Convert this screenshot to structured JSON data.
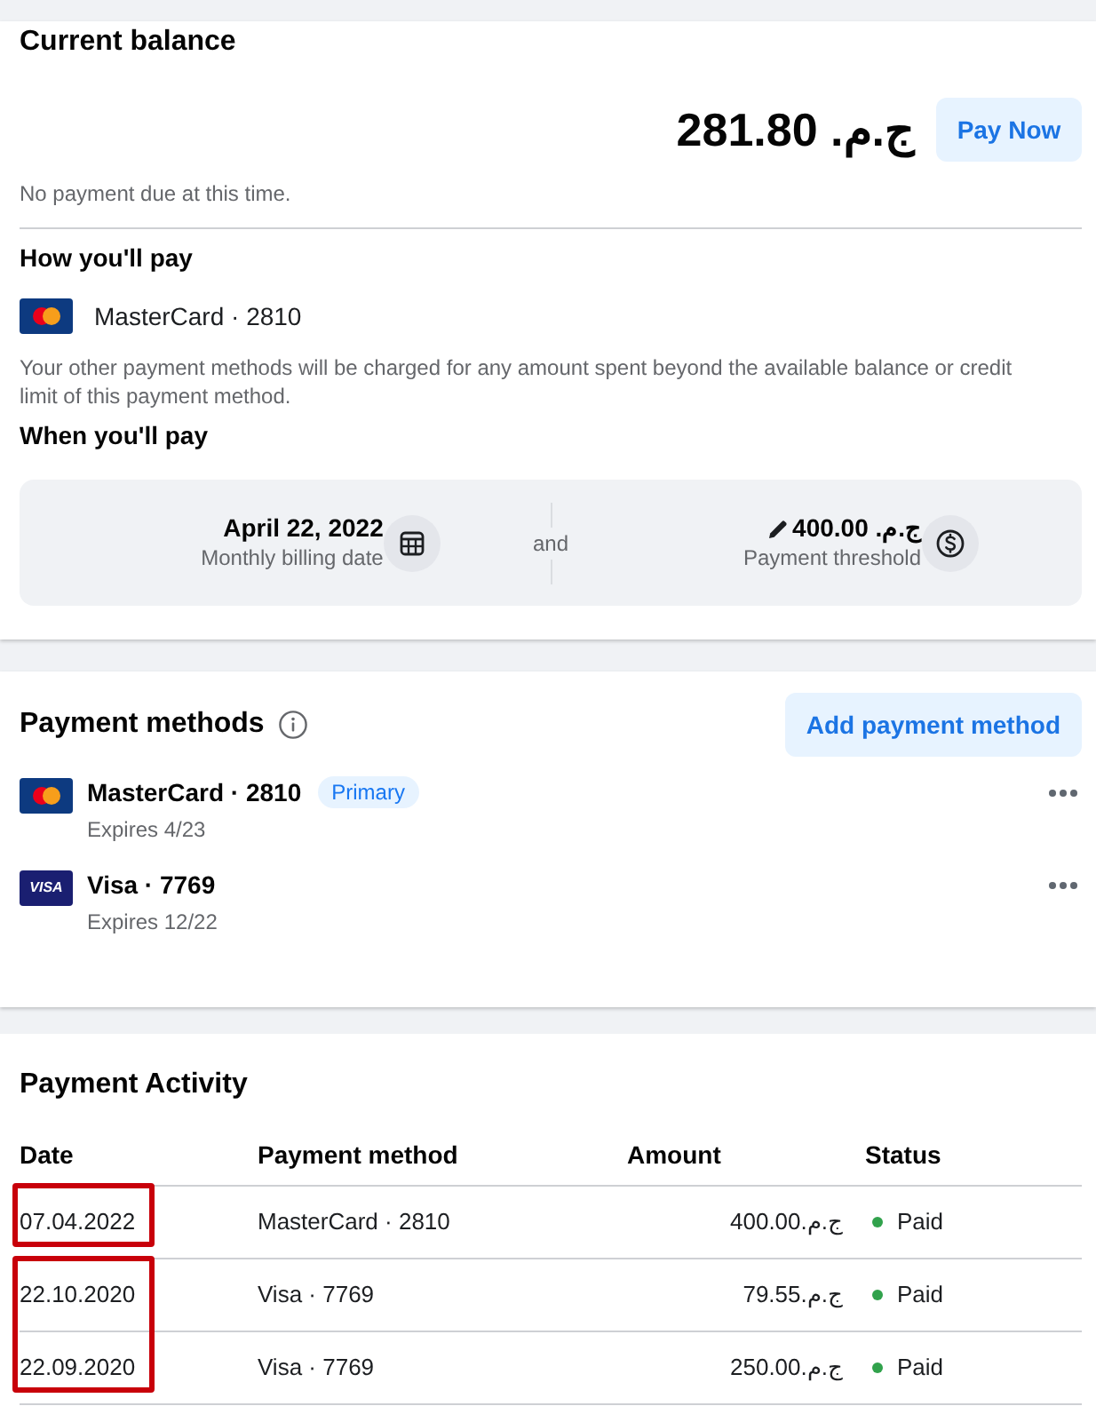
{
  "balance": {
    "title": "Current balance",
    "amount": "281.80 ج.م.‏",
    "button": "Pay Now",
    "note": "No payment due at this time."
  },
  "how_you_pay": {
    "title": "How you'll pay",
    "method": {
      "kind": "mastercard",
      "label": "MasterCard · 2810"
    },
    "note": "Your other payment methods will be charged for any amount spent beyond the available balance or credit limit of this payment method."
  },
  "when_you_pay": {
    "title": "When you'll pay",
    "billing_date": {
      "value": "April 22, 2022",
      "label": "Monthly billing date"
    },
    "separator": "and",
    "threshold": {
      "value": "400.00 ج.م.‏",
      "label": "Payment threshold"
    }
  },
  "payment_methods": {
    "title": "Payment methods",
    "button": "Add payment method",
    "items": [
      {
        "kind": "mastercard",
        "name": "MasterCard · 2810",
        "badge": "Primary",
        "expires": "Expires 4/23"
      },
      {
        "kind": "visa",
        "logo_text": "VISA",
        "name": "Visa · 7769",
        "expires": "Expires 12/22"
      }
    ]
  },
  "activity": {
    "title": "Payment Activity",
    "columns": [
      "Date",
      "Payment method",
      "Amount",
      "Status"
    ],
    "row_groups": [
      {
        "highlighted": true,
        "rows": [
          {
            "date": "07.04.2022",
            "method": "MasterCard · 2810",
            "amount": "400.00ج.م.‏",
            "status": "Paid",
            "color": "#31a24c"
          }
        ]
      },
      {
        "highlighted": true,
        "rows": [
          {
            "date": "22.10.2020",
            "method": "Visa · 7769",
            "amount": "79.55ج.م.‏",
            "status": "Paid",
            "color": "#31a24c"
          },
          {
            "date": "22.09.2020",
            "method": "Visa · 7769",
            "amount": "250.00ج.م.‏",
            "status": "Paid",
            "color": "#31a24c"
          }
        ]
      }
    ]
  }
}
